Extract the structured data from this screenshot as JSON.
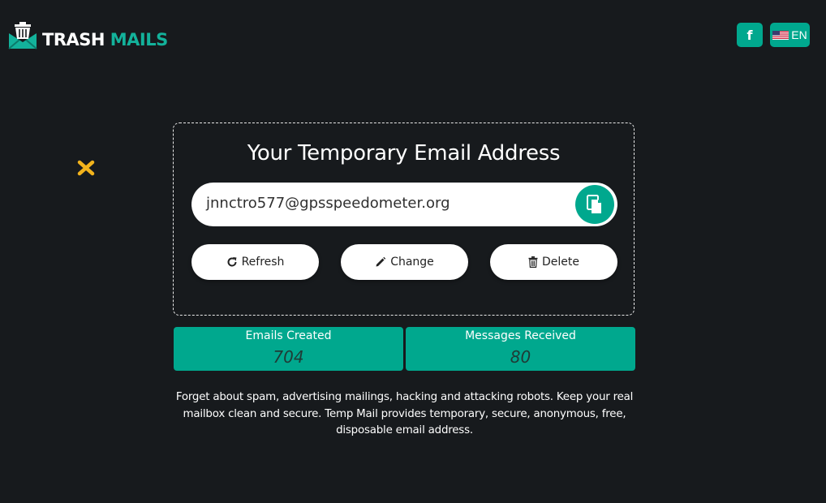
{
  "header": {
    "logo_word1": "TRASH",
    "logo_word2": "MAILS",
    "facebook_label": "f",
    "language_label": "EN",
    "language_flag": "us-flag-icon"
  },
  "ad": {
    "close_icon": "close-x-icon"
  },
  "card": {
    "title": "Your Temporary Email Address",
    "email": "jnnctro577@gpsspeedometer.org",
    "copy_icon": "copy-icon",
    "buttons": [
      {
        "label": "Refresh",
        "icon": "refresh-icon"
      },
      {
        "label": "Change",
        "icon": "pencil-icon"
      },
      {
        "label": "Delete",
        "icon": "trash-icon"
      }
    ]
  },
  "stats": [
    {
      "label": "Emails Created",
      "value": "704"
    },
    {
      "label": "Messages Received",
      "value": "80"
    }
  ],
  "description": "Forget about spam, advertising mailings, hacking and attacking robots. Keep your real mailbox clean and secure. Temp Mail provides temporary, secure, anonymous, free, disposable email address.",
  "colors": {
    "background": "#171a1d",
    "accent": "#00a88e",
    "ad_close": "#f2b31c"
  }
}
